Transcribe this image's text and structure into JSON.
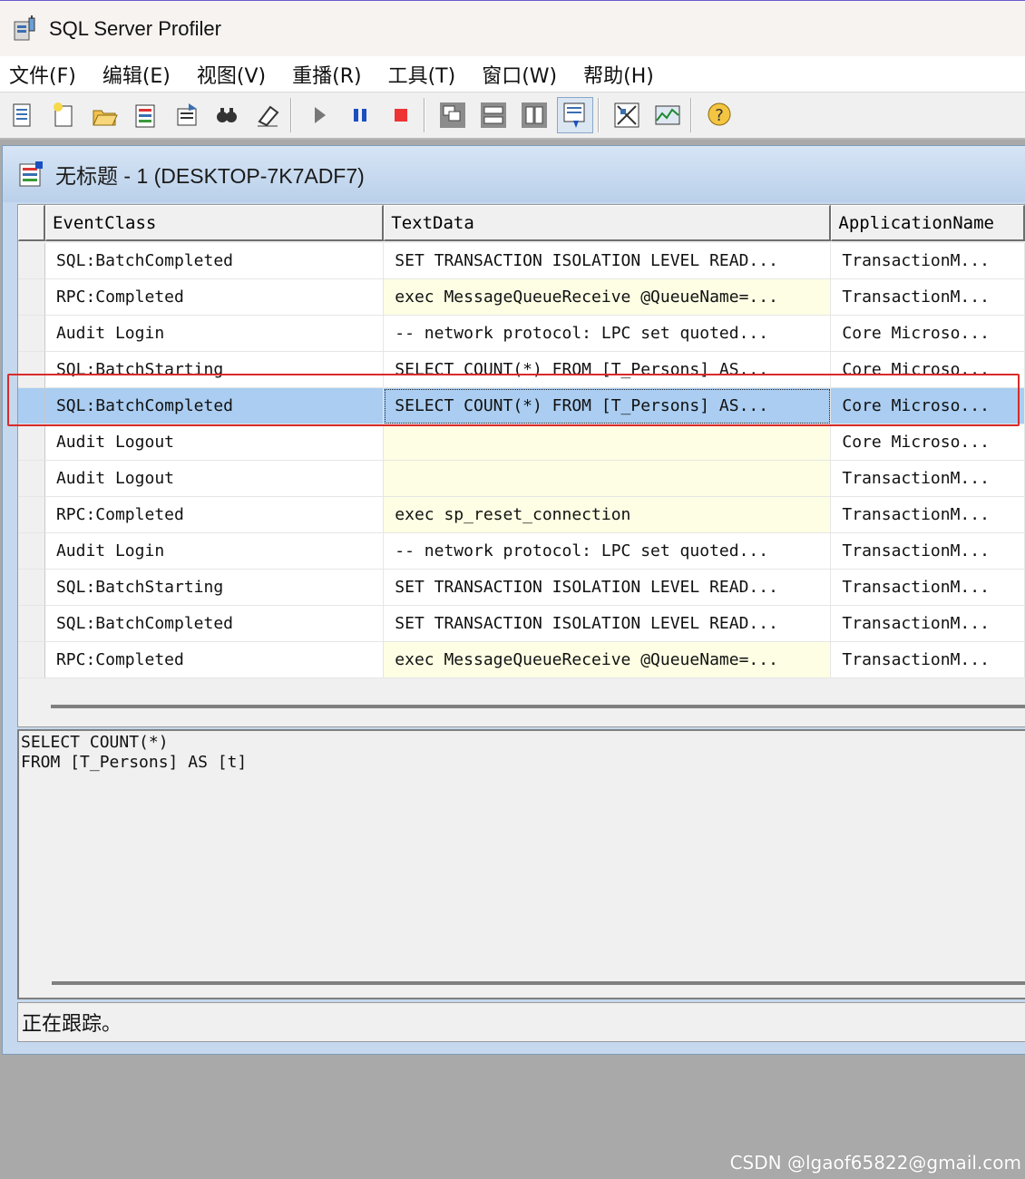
{
  "window": {
    "title": "SQL Server Profiler"
  },
  "menu": [
    "文件(F)",
    "编辑(E)",
    "视图(V)",
    "重播(R)",
    "工具(T)",
    "窗口(W)",
    "帮助(H)"
  ],
  "toolbar": {
    "buttons": [
      "new-trace-icon",
      "new-template-icon",
      "open-icon",
      "properties-icon",
      "template-properties-icon",
      "find-icon",
      "clear-icon",
      "run-icon",
      "pause-icon",
      "stop-icon",
      "cascade-icon",
      "tile-icon",
      "auto-scroll-icon",
      "scroll-trace-icon",
      "activity-monitor-icon",
      "perfmon-icon",
      "help-icon"
    ]
  },
  "trace_window": {
    "title": "无标题 - 1 (DESKTOP-7K7ADF7)"
  },
  "grid": {
    "columns": [
      "EventClass",
      "TextData",
      "ApplicationName"
    ],
    "rows": [
      {
        "event": "SQL:BatchCompleted",
        "text": "SET TRANSACTION ISOLATION LEVEL READ...",
        "app": "TransactionM...",
        "text_hl": false
      },
      {
        "event": "RPC:Completed",
        "text": "exec MessageQueueReceive @QueueName=...",
        "app": "TransactionM...",
        "text_hl": true
      },
      {
        "event": "Audit Login",
        "text": "-- network protocol: LPC  set quoted...",
        "app": "Core Microso...",
        "text_hl": false
      },
      {
        "event": "SQL:BatchStarting",
        "text": "SELECT COUNT(*)  FROM [T_Persons] AS...",
        "app": "Core Microso...",
        "text_hl": false
      },
      {
        "event": "SQL:BatchCompleted",
        "text": "SELECT COUNT(*)  FROM [T_Persons] AS...",
        "app": "Core Microso...",
        "text_hl": false,
        "selected": true
      },
      {
        "event": "Audit Logout",
        "text": "",
        "app": "Core Microso...",
        "text_hl": true
      },
      {
        "event": "Audit Logout",
        "text": "",
        "app": "TransactionM...",
        "text_hl": true
      },
      {
        "event": "RPC:Completed",
        "text": "exec sp_reset_connection",
        "app": "TransactionM...",
        "text_hl": true
      },
      {
        "event": "Audit Login",
        "text": "-- network protocol: LPC  set quoted...",
        "app": "TransactionM...",
        "text_hl": false
      },
      {
        "event": "SQL:BatchStarting",
        "text": "SET TRANSACTION ISOLATION LEVEL READ...",
        "app": "TransactionM...",
        "text_hl": false
      },
      {
        "event": "SQL:BatchCompleted",
        "text": "SET TRANSACTION ISOLATION LEVEL READ...",
        "app": "TransactionM...",
        "text_hl": false
      },
      {
        "event": "RPC:Completed",
        "text": "exec MessageQueueReceive @QueueName=...",
        "app": "TransactionM...",
        "text_hl": true
      }
    ]
  },
  "text_pane": {
    "content": "SELECT COUNT(*)\nFROM [T_Persons] AS [t]"
  },
  "status": {
    "text": "正在跟踪。"
  },
  "watermark": "CSDN @lgaof65822@gmail.com",
  "colors": {
    "selected_row": "#aacdf1",
    "text_highlight": "#fefee4",
    "annotation_box": "#d92b2b"
  }
}
